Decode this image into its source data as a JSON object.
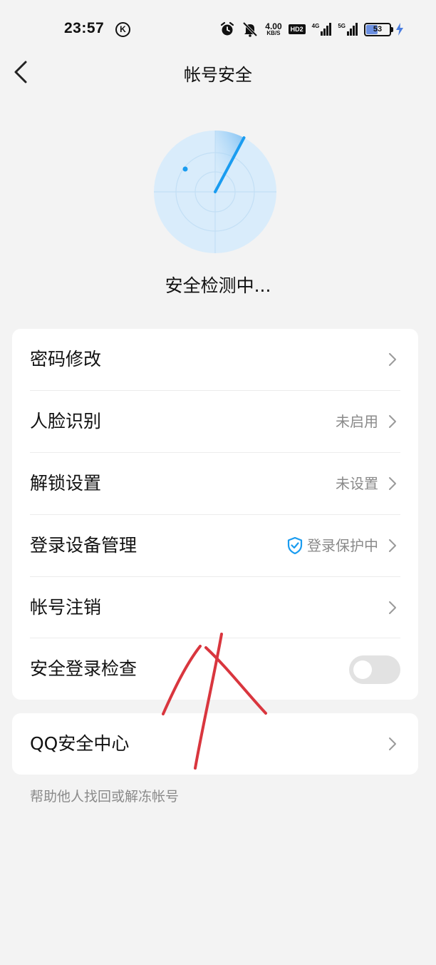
{
  "status_bar": {
    "time": "23:57",
    "k_badge": "K",
    "net_speed_value": "4.00",
    "net_speed_unit": "KB/S",
    "hd_badge": "HD2",
    "signal_1_label": "4G",
    "signal_2_label": "5G",
    "battery_level": "53",
    "battery_fraction": 0.53
  },
  "header": {
    "title": "帐号安全"
  },
  "scan": {
    "status_text": "安全检测中..."
  },
  "settings": {
    "items": [
      {
        "label": "密码修改",
        "value": ""
      },
      {
        "label": "人脸识别",
        "value": "未启用"
      },
      {
        "label": "解锁设置",
        "value": "未设置"
      },
      {
        "label": "登录设备管理",
        "value": "登录保护中"
      },
      {
        "label": "帐号注销",
        "value": ""
      },
      {
        "label": "安全登录检查",
        "toggle_on": false
      }
    ]
  },
  "qq_security": {
    "label": "QQ安全中心",
    "footnote": "帮助他人找回或解冻帐号"
  },
  "colors": {
    "accent": "#1a9cf0",
    "radar_fill": "#d9ecfb",
    "scribble": "#d9363e"
  }
}
